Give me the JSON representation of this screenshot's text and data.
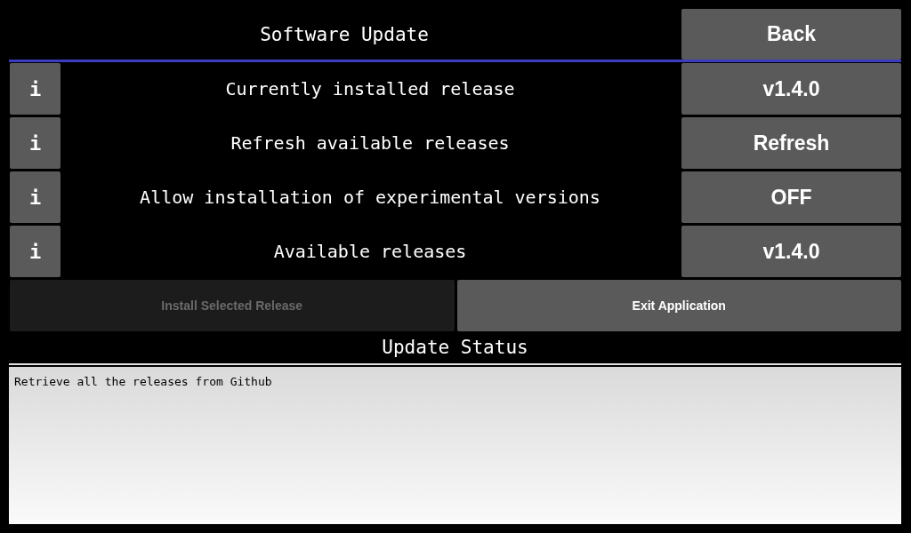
{
  "header": {
    "title": "Software Update",
    "back_button": "Back"
  },
  "rows": [
    {
      "info": "i",
      "label": "Currently installed release",
      "value": "v1.4.0"
    },
    {
      "info": "i",
      "label": "Refresh available releases",
      "value": "Refresh"
    },
    {
      "info": "i",
      "label": "Allow installation of experimental versions",
      "value": "OFF"
    },
    {
      "info": "i",
      "label": "Available releases",
      "value": "v1.4.0"
    }
  ],
  "actions": [
    {
      "label": "Install Selected Release",
      "disabled": true
    },
    {
      "label": "Exit Application",
      "disabled": false
    }
  ],
  "status": {
    "title": "Update Status",
    "log": "Retrieve all the releases from Github"
  }
}
